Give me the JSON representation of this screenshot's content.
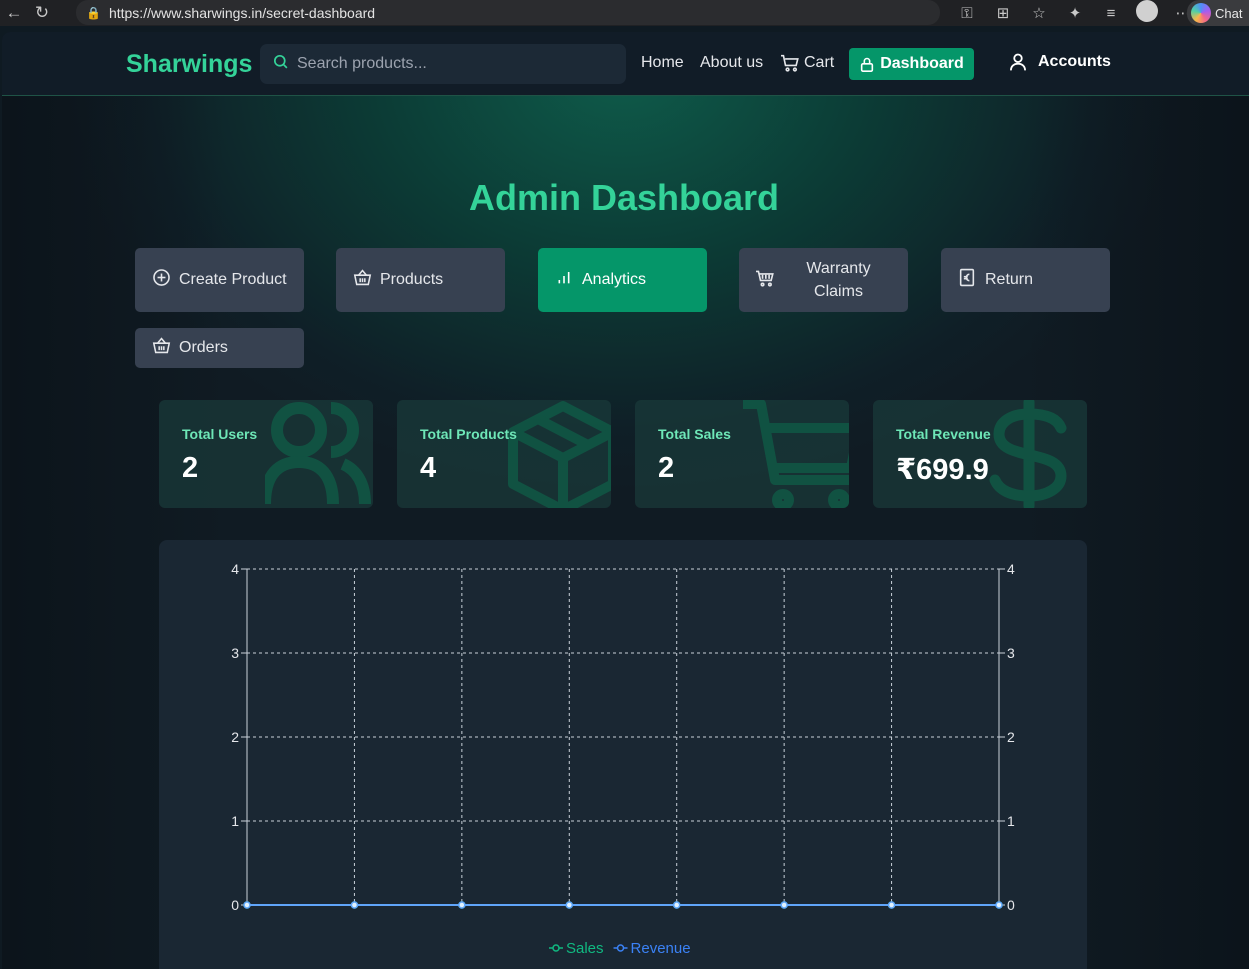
{
  "browser": {
    "url": "https://www.sharwings.in/secret-dashboard",
    "chat_label": "Chat"
  },
  "nav": {
    "brand": "Sharwings",
    "search_placeholder": "Search products...",
    "home": "Home",
    "about": "About us",
    "cart": "Cart",
    "dashboard": "Dashboard",
    "accounts": "Accounts"
  },
  "page_title": "Admin Dashboard",
  "tabs": [
    {
      "label": "Create Product",
      "icon": "plus-circle-icon",
      "active": false
    },
    {
      "label": "Products",
      "icon": "basket-icon",
      "active": false
    },
    {
      "label": "Analytics",
      "icon": "bar-chart-icon",
      "active": true
    },
    {
      "label": "Warranty Claims",
      "icon": "shopping-cart-icon",
      "active": false
    },
    {
      "label": "Return",
      "icon": "euro-receipt-icon",
      "active": false
    },
    {
      "label": "Orders",
      "icon": "basket-icon",
      "active": false
    }
  ],
  "stats": [
    {
      "label": "Total Users",
      "value": "2",
      "icon": "users-icon"
    },
    {
      "label": "Total Products",
      "value": "4",
      "icon": "package-icon"
    },
    {
      "label": "Total Sales",
      "value": "2",
      "icon": "cart-icon"
    },
    {
      "label": "Total Revenue",
      "value": "₹699.9",
      "icon": "dollar-icon"
    }
  ],
  "colors": {
    "accent": "#34d399",
    "active_button": "#059669",
    "sales_line": "#10b981",
    "revenue_line": "#3b82f6"
  },
  "chart_data": {
    "type": "line",
    "x": [
      1,
      2,
      3,
      4,
      5,
      6,
      7,
      8
    ],
    "series": [
      {
        "name": "Sales",
        "values": [
          0,
          0,
          0,
          0,
          0,
          0,
          0,
          0
        ],
        "axis": "left"
      },
      {
        "name": "Revenue",
        "values": [
          0,
          0,
          0,
          0,
          0,
          0,
          0,
          0
        ],
        "axis": "right"
      }
    ],
    "ylim_left": [
      0,
      4
    ],
    "ylim_right": [
      0,
      4
    ],
    "yticks": [
      "0",
      "1",
      "2",
      "3",
      "4"
    ],
    "grid": true,
    "legend": "bottom-center"
  }
}
